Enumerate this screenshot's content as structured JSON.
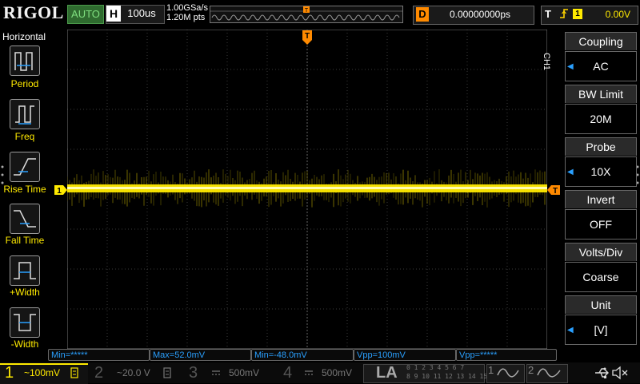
{
  "colors": {
    "ch1": "#ffea00",
    "ch2": "#00e0ff",
    "ch3": "#ff4fff",
    "ch4": "#3a7bff",
    "trigger_orange": "#ff8a00",
    "menu_arrow": "#2aa0ff"
  },
  "top": {
    "logo": "RIGOL",
    "run_state": "AUTO",
    "horizontal_label": "H",
    "timebase": "100us",
    "sample_rate": "1.00GSa/s",
    "memory_depth": "1.20M pts",
    "trigger_pos_marker": "T",
    "delay_label": "D",
    "delay_value": "0.00000000ps",
    "trigger_label": "T",
    "trigger_edge_icon": "rising-edge-icon",
    "trigger_source": "1",
    "trigger_level": "0.00V"
  },
  "left_panel": {
    "title": "Horizontal",
    "items": [
      {
        "label": "Period",
        "icon": "period-icon"
      },
      {
        "label": "Freq",
        "icon": "freq-icon"
      },
      {
        "label": "Rise Time",
        "icon": "rise-time-icon"
      },
      {
        "label": "Fall Time",
        "icon": "fall-time-icon"
      },
      {
        "label": "+Width",
        "icon": "positive-width-icon"
      },
      {
        "label": "-Width",
        "icon": "negative-width-icon"
      }
    ]
  },
  "grid_markers": {
    "trigger_top": "T",
    "ch1_left": "1",
    "trigger_right": "T"
  },
  "right_menu": {
    "channel_label": "CH1",
    "items": [
      {
        "title": "Coupling",
        "value": "AC",
        "has_arrow": true
      },
      {
        "title": "BW Limit",
        "value": "20M",
        "has_arrow": false
      },
      {
        "title": "Probe",
        "value": "10X",
        "has_arrow": true
      },
      {
        "title": "Invert",
        "value": "OFF",
        "has_arrow": false
      },
      {
        "title": "Volts/Div",
        "value": "Coarse",
        "has_arrow": false
      },
      {
        "title": "Unit",
        "value": "[V]",
        "has_arrow": true
      }
    ]
  },
  "measurements": [
    "Min=*****",
    "Max=52.0mV",
    "Min=-48.0mV",
    "Vpp=100mV",
    "Vpp=*****"
  ],
  "bottom": {
    "ch1": {
      "num": "1",
      "value": "~100mV"
    },
    "ch2": {
      "num": "2",
      "value": "~20.0 V"
    },
    "ch3": {
      "num": "3",
      "value": "500mV"
    },
    "ch4": {
      "num": "4",
      "value": "500mV"
    },
    "la": "LA",
    "digital_top": "0 1 2 3  4 5 6 7",
    "digital_bottom": "8 9 10 11  12 13 14 15",
    "gen1": "1",
    "gen2": "2"
  }
}
